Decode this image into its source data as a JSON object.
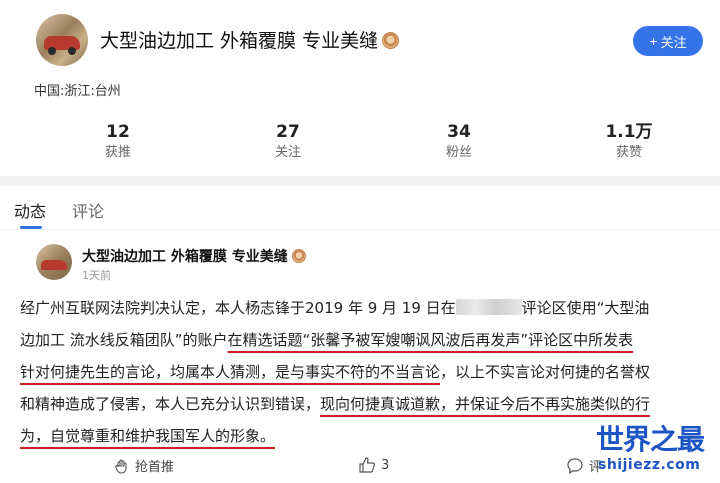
{
  "profile": {
    "name": "大型油边加工 外箱覆膜 专业美缝",
    "location": "中国:浙江:台州",
    "follow_label": "关注",
    "follow_icon": "plus-icon"
  },
  "stats": [
    {
      "value": "12",
      "label": "获推"
    },
    {
      "value": "27",
      "label": "关注"
    },
    {
      "value": "34",
      "label": "粉丝"
    },
    {
      "value": "1.1万",
      "label": "获赞"
    }
  ],
  "tabs": {
    "active": "动态",
    "other": "评论"
  },
  "post": {
    "author": "大型油边加工 外箱覆膜 专业美缝",
    "time": "1天前",
    "lines": [
      {
        "a": "经广州互联网法院判决认定，本人杨志锋于2019 年 9 月 19 日在",
        "b": "评论区使用“大型油"
      },
      {
        "a": "边加工 流水线反箱团队”的账户",
        "b": "在精选话题“张馨予被军嫂嘲讽风波后再发声”评论区中所发表"
      },
      {
        "a": "针对何捷先生的言论，均属本人猜测，是与事实不符的不当言论",
        "b": "，以上不实言论对何捷的名誉权"
      },
      {
        "a": "和精神造成了侵害，本人已充分认识到错误，",
        "b": "现向何捷真诚道歉，并保证今后不再实施类似的行"
      },
      {
        "a": "为，自觉尊重和维护我国军人的形象。"
      }
    ]
  },
  "actions": {
    "grab_label": "抢首推",
    "like_count": "3",
    "comment_label": "评"
  },
  "watermark": {
    "cn": "世界之最",
    "en": "shijiezz.com"
  },
  "colors": {
    "accent": "#3574e8",
    "underline": "#d0212a",
    "watermark": "#1d55c4"
  }
}
